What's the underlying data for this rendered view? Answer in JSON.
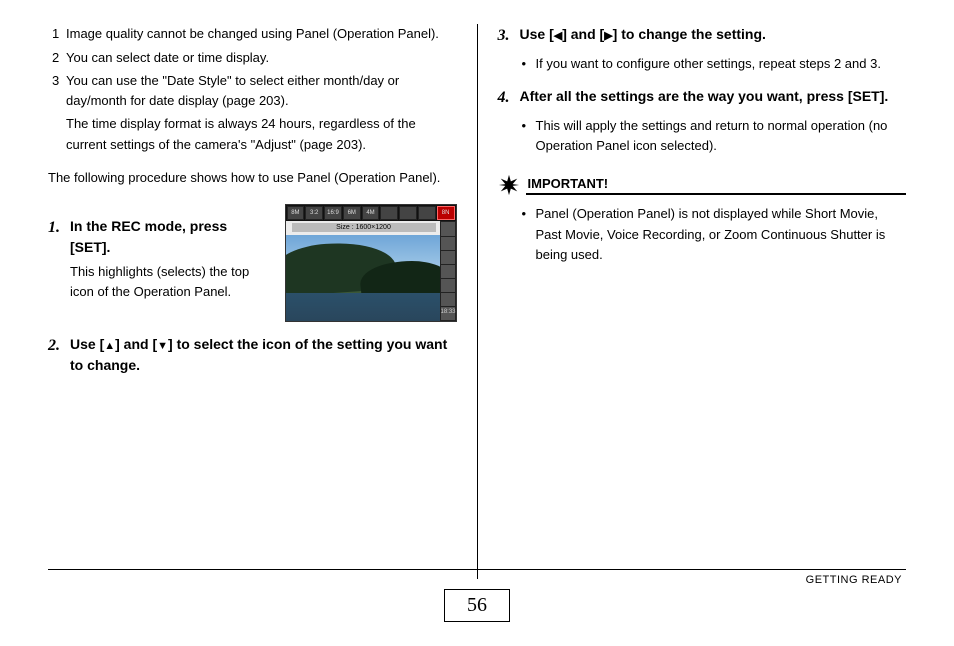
{
  "notes": [
    {
      "num": "1",
      "text": "Image quality cannot be changed using Panel (Operation Panel)."
    },
    {
      "num": "2",
      "text": "You can select date or time display."
    },
    {
      "num": "3",
      "text": "You can use the \"Date Style\" to select either month/day or day/month for date display (page 203)."
    }
  ],
  "note_sub": "The time display format is always 24 hours, regardless of the current settings of the camera's \"Adjust\" (page 203).",
  "intro": "The following procedure shows how to use Panel (Operation Panel).",
  "steps": {
    "s1_num": "1.",
    "s1_head": "In the REC mode, press [SET].",
    "s1_note": "This highlights (selects) the top icon of the Operation Panel.",
    "s2_num": "2.",
    "s2_head_a": "Use [",
    "s2_head_b": "] and [",
    "s2_head_c": "] to select the icon of the setting you want to change.",
    "s3_num": "3.",
    "s3_head_a": "Use [",
    "s3_head_b": "] and [",
    "s3_head_c": "] to change the setting.",
    "s3_bullet": "If you want to configure other settings, repeat steps 2 and 3.",
    "s4_num": "4.",
    "s4_head": "After all the settings are the way you want, press [SET].",
    "s4_bullet": "This will apply the settings and return to normal operation (no Operation Panel icon selected)."
  },
  "important_label": "IMPORTANT!",
  "important_bullet": "Panel (Operation Panel) is not displayed while Short Movie, Past Movie, Voice Recording, or Zoom Continuous Shutter is being used.",
  "camera": {
    "size_label": "Size : 1600×1200",
    "top_icons": [
      "8M",
      "3:2",
      "16:9",
      "6M",
      "4M",
      "",
      "",
      "",
      "8N"
    ],
    "time": "18:33"
  },
  "footer": {
    "section": "GETTING READY"
  },
  "page_number": "56",
  "glyphs": {
    "up": "▲",
    "down": "▼",
    "left": "◀",
    "right": "▶"
  }
}
